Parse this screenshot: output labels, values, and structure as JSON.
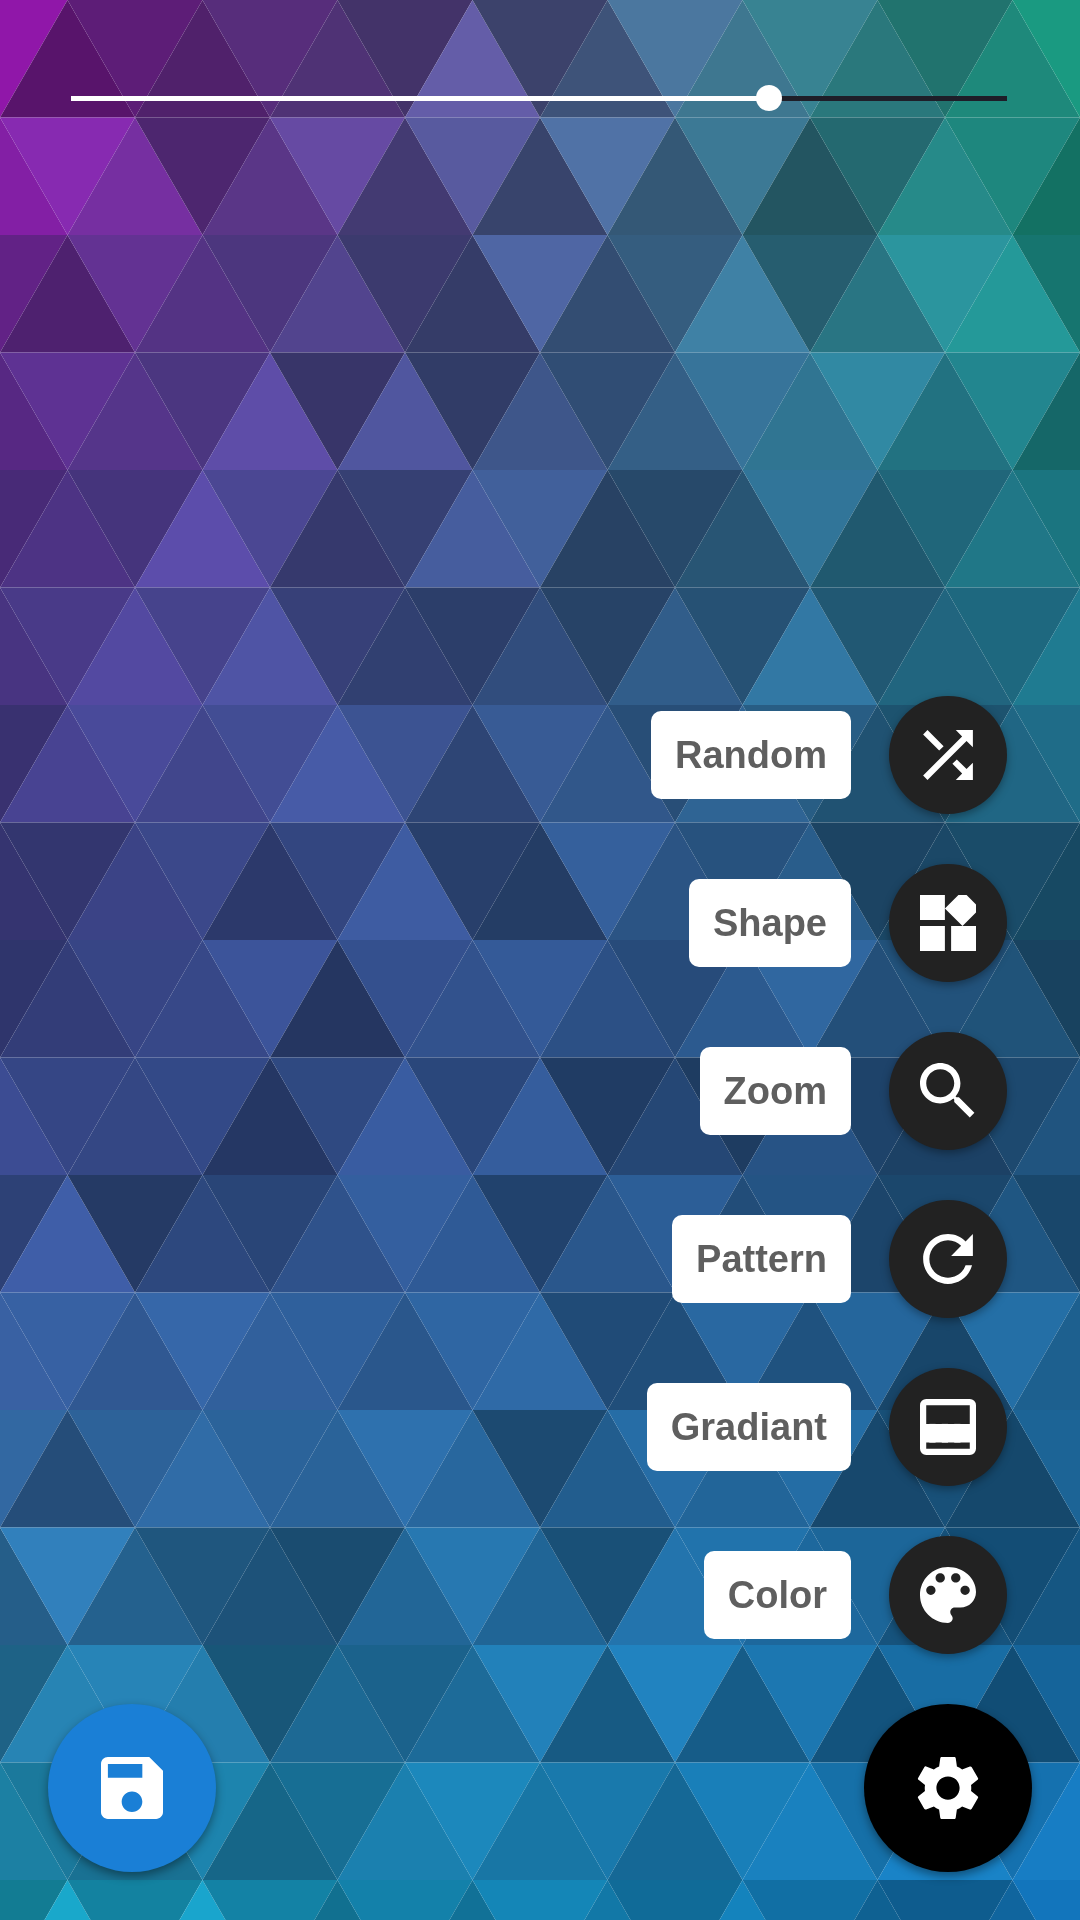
{
  "slider": {
    "level": 0.746
  },
  "actions": [
    {
      "label": "Random",
      "kind": "shuffle"
    },
    {
      "label": "Shape",
      "kind": "shapes"
    },
    {
      "label": "Zoom",
      "kind": "zoom"
    },
    {
      "label": "Pattern",
      "kind": "refresh"
    },
    {
      "label": "Gradiant",
      "kind": "gradient"
    },
    {
      "label": "Color",
      "kind": "palette"
    }
  ]
}
